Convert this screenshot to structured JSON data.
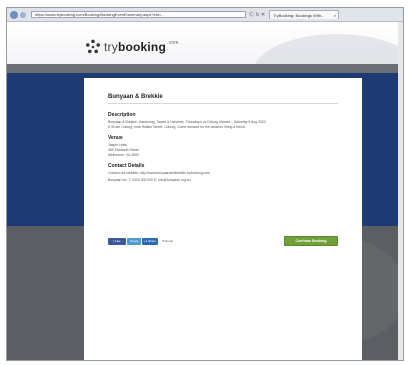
{
  "browser": {
    "url": "https://www.trybooking.com/Booking/BookingEventSummary.aspx?eid=...",
    "controls": "Ⓒ ↻ ✕",
    "tab_label": "TryBooking: Bookings With...",
    "tab_close": "×"
  },
  "site": {
    "logo_light": "try",
    "logo_bold": "booking",
    "logo_suffix": ".com"
  },
  "event": {
    "title": "Bunyaan & Brekkie",
    "description_heading": "Description",
    "description_lines": [
      "Bunyaan & Brekkie: Gardening, Tastes & Harvests, Thursday’s at Coburg Victoria – Saturday 6 Aug 2022,",
      "8:30 am Coburg, near Walker Street, Coburg. Come dressed for the weather. Bring a friend."
    ],
    "venue_heading": "Venue",
    "venue_lines": [
      "Jasper Hotel",
      "489 Elizabeth Street",
      "Melbourne, Vic 3000"
    ],
    "contact_heading": "Contact Details",
    "contact_lines": [
      "Contact our website: http://www.bunyaanandbrekkie.trybooking.com",
      "Bunyaan Inc. T: 0400 000 000  E: info@bunyaan.org.au"
    ]
  },
  "share": {
    "facebook": "f Like",
    "twitter": "Tweet",
    "gplus": "+1 Share",
    "email": "✉ Email"
  },
  "booking": {
    "button_label": "Continue Booking"
  }
}
